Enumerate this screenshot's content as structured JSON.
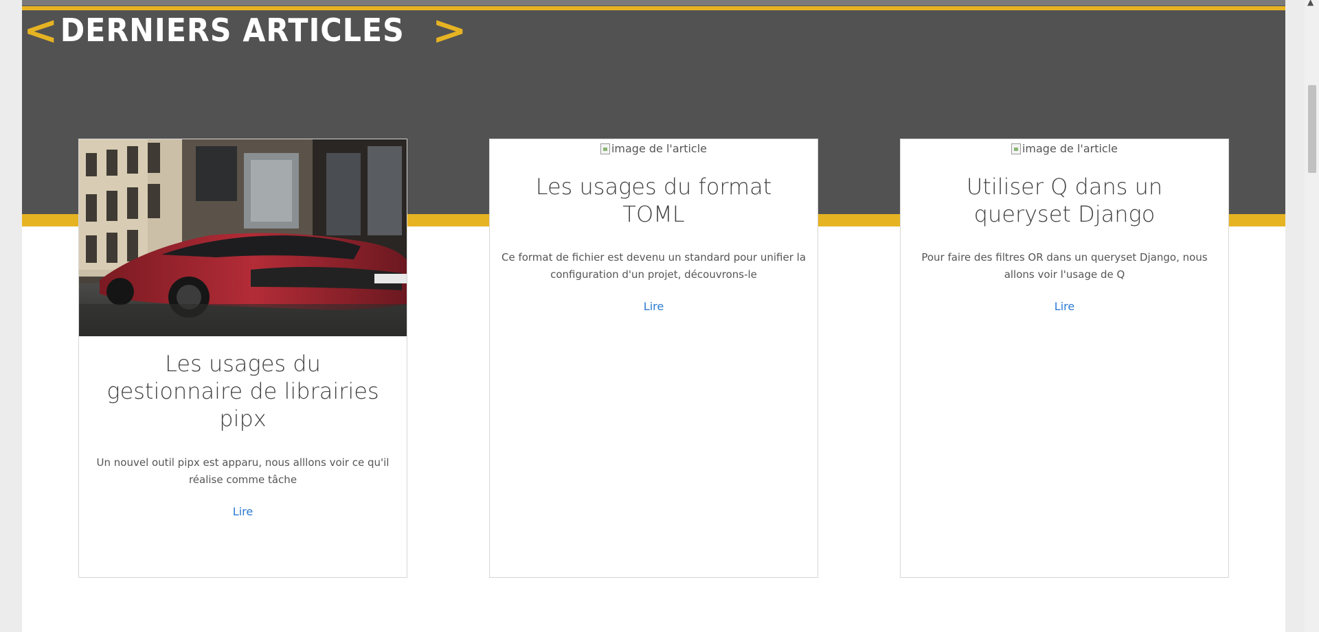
{
  "section": {
    "bracket_left": "<",
    "title": "DERNIERS ARTICLES",
    "bracket_right": ">"
  },
  "colors": {
    "dark_band": "#525252",
    "accent_gold": "#e6b323",
    "link": "#2a7ad2"
  },
  "articles": [
    {
      "image_alt": "image de l'article",
      "image_loaded": true,
      "title": "Les usages du gestionnaire de librairies pipx",
      "description": "Un nouvel outil pipx est apparu, nous alllons voir ce qu'il réalise comme tâche",
      "link_label": "Lire"
    },
    {
      "image_alt": "image de l'article",
      "image_loaded": false,
      "title": "Les usages du format TOML",
      "description": "Ce format de fichier est devenu un standard pour unifier la configuration d'un projet, découvrons-le",
      "link_label": "Lire"
    },
    {
      "image_alt": "image de l'article",
      "image_loaded": false,
      "title": "Utiliser Q dans un queryset Django",
      "description": "Pour faire des filtres OR dans un queryset Django, nous allons voir l'usage de Q",
      "link_label": "Lire"
    }
  ],
  "scrollbar": {
    "up_arrow": "▲"
  }
}
